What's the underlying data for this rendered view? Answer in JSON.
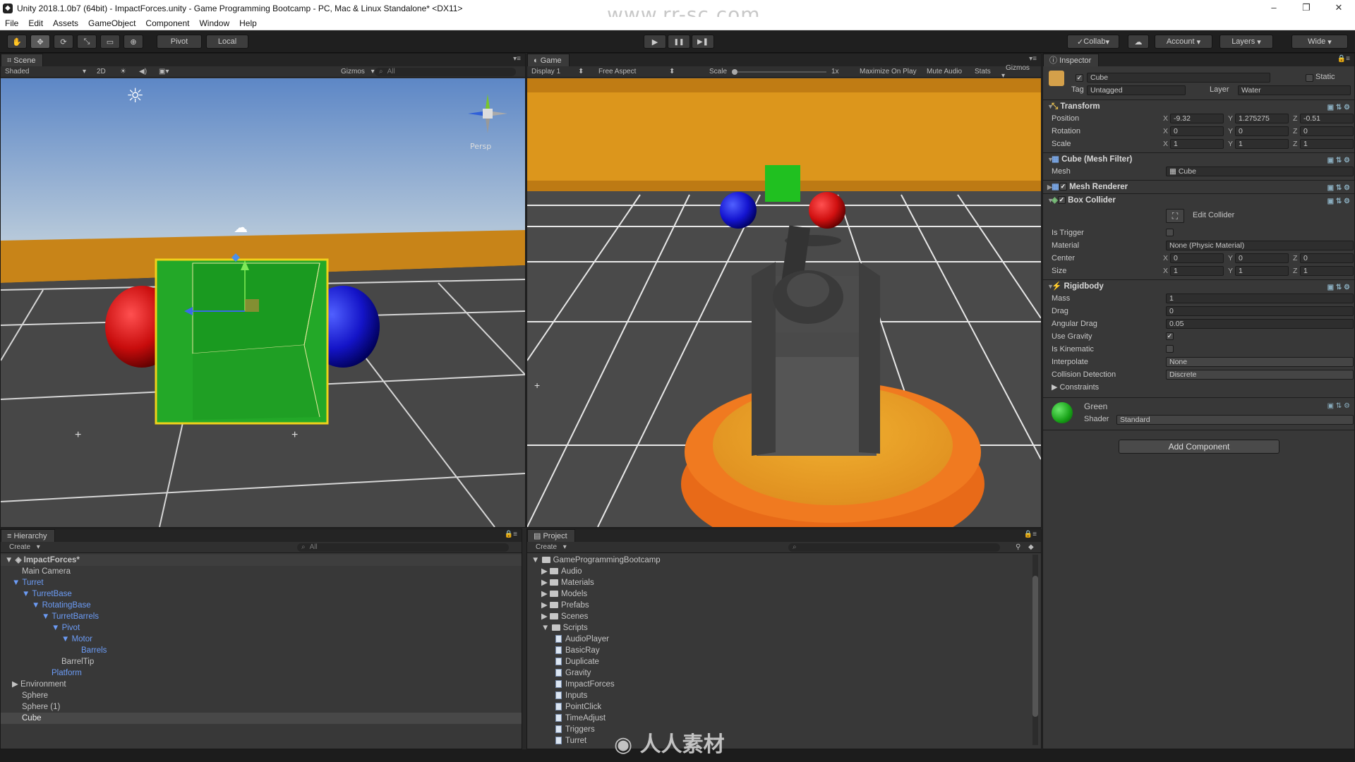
{
  "window": {
    "title": "Unity 2018.1.0b7 (64bit) - ImpactForces.unity - Game Programming Bootcamp - PC, Mac & Linux Standalone* <DX11>",
    "watermark": "www.rr-sc.com",
    "controls": [
      "–",
      "❐",
      "✕"
    ]
  },
  "menu": [
    "File",
    "Edit",
    "Assets",
    "GameObject",
    "Component",
    "Window",
    "Help"
  ],
  "toolbar": {
    "pivot": "Pivot",
    "local": "Local",
    "collab": "Collab",
    "account": "Account",
    "layers": "Layers",
    "layout": "Wide",
    "tools": [
      "✋",
      "✥",
      "⟳",
      "⤡",
      "▭",
      "⊕"
    ],
    "play": "▶",
    "pause": "❚❚",
    "step": "▶❚"
  },
  "scene": {
    "tab": "Scene",
    "shading": "Shaded",
    "mode2d": "2D",
    "gizmos": "Gizmos",
    "search": "All",
    "persp": "Persp"
  },
  "game": {
    "tab": "Game",
    "display": "Display 1",
    "aspect": "Free Aspect",
    "scale_label": "Scale",
    "scale_value": "1x",
    "maximize": "Maximize On Play",
    "mute": "Mute Audio",
    "stats": "Stats",
    "gizmos": "Gizmos"
  },
  "inspector": {
    "tab": "Inspector",
    "object_name": "Cube",
    "static_label": "Static",
    "tag_label": "Tag",
    "tag_value": "Untagged",
    "layer_label": "Layer",
    "layer_value": "Water",
    "transform": {
      "title": "Transform",
      "position_label": "Position",
      "rotation_label": "Rotation",
      "scale_label": "Scale",
      "position": {
        "x": "-9.32",
        "y": "1.275275",
        "z": "-0.51"
      },
      "rotation": {
        "x": "0",
        "y": "0",
        "z": "0"
      },
      "scale": {
        "x": "1",
        "y": "1",
        "z": "1"
      }
    },
    "mesh_filter": {
      "title": "Cube (Mesh Filter)",
      "mesh_label": "Mesh",
      "mesh_value": "Cube"
    },
    "mesh_renderer": {
      "title": "Mesh Renderer"
    },
    "box_collider": {
      "title": "Box Collider",
      "edit": "Edit Collider",
      "is_trigger": "Is Trigger",
      "material_label": "Material",
      "material_value": "None (Physic Material)",
      "center_label": "Center",
      "center": {
        "x": "0",
        "y": "0",
        "z": "0"
      },
      "size_label": "Size",
      "size": {
        "x": "1",
        "y": "1",
        "z": "1"
      }
    },
    "rigidbody": {
      "title": "Rigidbody",
      "mass_label": "Mass",
      "mass": "1",
      "drag_label": "Drag",
      "drag": "0",
      "angular_drag_label": "Angular Drag",
      "angular_drag": "0.05",
      "use_gravity_label": "Use Gravity",
      "is_kinematic_label": "Is Kinematic",
      "interpolate_label": "Interpolate",
      "interpolate": "None",
      "collision_label": "Collision Detection",
      "collision": "Discrete",
      "constraints_label": "Constraints"
    },
    "material": {
      "name": "Green",
      "shader_label": "Shader",
      "shader": "Standard"
    },
    "add_component": "Add Component"
  },
  "hierarchy": {
    "tab": "Hierarchy",
    "create": "Create",
    "search": "All",
    "scene": "ImpactForces*",
    "items": [
      "Main Camera",
      "Turret",
      "TurretBase",
      "RotatingBase",
      "TurretBarrels",
      "Pivot",
      "Motor",
      "Barrels",
      "BarrelTip",
      "Platform",
      "Environment",
      "Sphere",
      "Sphere (1)",
      "Cube"
    ]
  },
  "project": {
    "tab": "Project",
    "create": "Create",
    "root": "GameProgrammingBootcamp",
    "folders": [
      "Audio",
      "Materials",
      "Models",
      "Prefabs",
      "Scenes",
      "Scripts"
    ],
    "scripts": [
      "AudioPlayer",
      "BasicRay",
      "Duplicate",
      "Gravity",
      "ImpactForces",
      "Inputs",
      "PointClick",
      "TimeAdjust",
      "Triggers",
      "Turret"
    ]
  },
  "bottom_watermark": "人人素材",
  "colors": {
    "panel": "#383838",
    "selected_blue": "#6c9cf6",
    "sky_top": "#5a86c8",
    "wall": "#d08a1a",
    "floor": "#4a4a4a",
    "cube_green": "#22a82a",
    "sphere_red": "#d81818",
    "sphere_blue": "#1a22d0"
  }
}
